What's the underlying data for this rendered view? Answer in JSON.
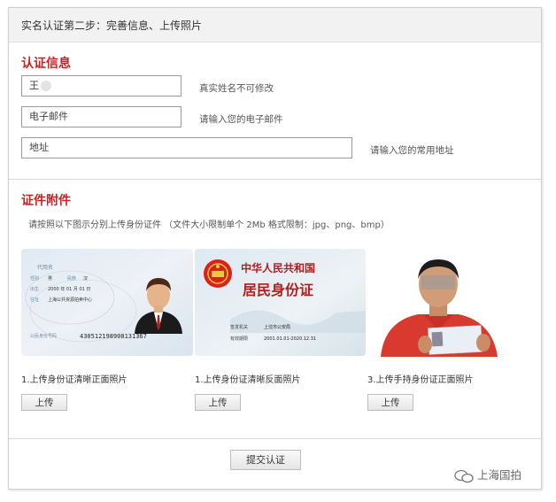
{
  "header": {
    "title": "实名认证第二步：完善信息、上传照片"
  },
  "info_section": {
    "title": "认证信息",
    "name_value": "王",
    "name_hint": "真实姓名不可修改",
    "email_placeholder": "电子邮件",
    "email_hint": "请输入您的电子邮件",
    "address_placeholder": "地址",
    "address_hint": "请输入您的常用地址"
  },
  "attachment_section": {
    "title": "证件附件",
    "description": "请按照以下图示分别上传身份证件 （文件大小限制单个 2Mb 格式限制：jpg、png、bmp）",
    "items": [
      {
        "caption": "1.上传身份证清晰正面照片",
        "button": "上传"
      },
      {
        "caption": "1.上传身份证清晰反面照片",
        "button": "上传"
      },
      {
        "caption": "3.上传手持身份证正面照片",
        "button": "上传"
      }
    ],
    "front_card": {
      "name_label": "代用名",
      "gender_label": "性别",
      "gender_value": "男",
      "ethnic_label": "民族",
      "ethnic_value": "汉",
      "birth_label": "出生",
      "birth_value": "2000  年  01  月  01  日",
      "address_label": "住址",
      "address_value": "上海公共资源拍卖中心",
      "id_label": "公民身份号码",
      "id_number": "430512198908131367"
    },
    "back_card": {
      "title1": "中华人民共和国",
      "title2": "居民身份证",
      "issuer_label": "签发机关",
      "issuer_value": "上沈市公安局",
      "validity_label": "有效期限",
      "validity_value": "2001.01.01-2020.12.31"
    }
  },
  "submit": {
    "label": "提交认证"
  },
  "watermark": {
    "text": "上海国拍"
  },
  "colors": {
    "section_title": "#cc1f1f",
    "header_bg": "#f2f2f2"
  }
}
